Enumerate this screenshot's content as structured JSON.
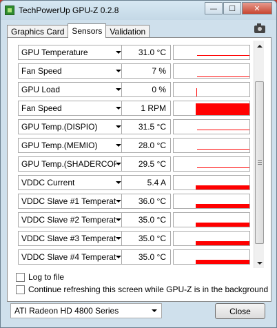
{
  "window": {
    "title": "TechPowerUp GPU-Z 0.2.8",
    "minimize_glyph": "—",
    "maximize_glyph": "☐",
    "close_glyph": "✕"
  },
  "tabs": [
    {
      "label": "Graphics Card",
      "active": false
    },
    {
      "label": "Sensors",
      "active": true
    },
    {
      "label": "Validation",
      "active": false
    }
  ],
  "sensors": [
    {
      "name": "GPU Temperature",
      "value": "31.0 °C",
      "graph": {
        "kind": "line",
        "level": 0.25
      }
    },
    {
      "name": "Fan Speed",
      "value": "7 %",
      "graph": {
        "kind": "line",
        "level": 0.07
      }
    },
    {
      "name": "GPU Load",
      "value": "0 %",
      "graph": {
        "kind": "spike",
        "level": 0.0
      }
    },
    {
      "name": "Fan Speed",
      "value": "1 RPM",
      "graph": {
        "kind": "bar",
        "level": 0.85
      }
    },
    {
      "name": "GPU Temp.(DISPIO)",
      "value": "31.5 °C",
      "graph": {
        "kind": "line",
        "level": 0.25
      }
    },
    {
      "name": "GPU Temp.(MEMIO)",
      "value": "28.0 °C",
      "graph": {
        "kind": "line",
        "level": 0.2
      }
    },
    {
      "name": "GPU Temp.(SHADERCORE)",
      "value": "29.5 °C",
      "graph": {
        "kind": "line",
        "level": 0.22
      }
    },
    {
      "name": "VDDC Current",
      "value": "5.4 A",
      "graph": {
        "kind": "bar",
        "level": 0.3
      }
    },
    {
      "name": "VDDC Slave #1 Temperature",
      "value": "36.0 °C",
      "graph": {
        "kind": "bar",
        "level": 0.3
      }
    },
    {
      "name": "VDDC Slave #2 Temperature",
      "value": "35.0 °C",
      "graph": {
        "kind": "bar",
        "level": 0.3
      }
    },
    {
      "name": "VDDC Slave #3 Temperature",
      "value": "35.0 °C",
      "graph": {
        "kind": "bar",
        "level": 0.3
      }
    },
    {
      "name": "VDDC Slave #4 Temperature",
      "value": "35.0 °C",
      "graph": {
        "kind": "bar",
        "level": 0.3
      }
    }
  ],
  "options": {
    "log_to_file": {
      "label": "Log to file",
      "checked": false
    },
    "continue_refresh": {
      "label": "Continue refreshing this screen while GPU-Z is in the background",
      "checked": false
    }
  },
  "gpu_select": {
    "value": "ATI Radeon HD 4800 Series"
  },
  "close_label": "Close",
  "colors": {
    "graph": "#ff0000",
    "window_bg": "#cfe0ec",
    "desktop": "#c0392b"
  }
}
